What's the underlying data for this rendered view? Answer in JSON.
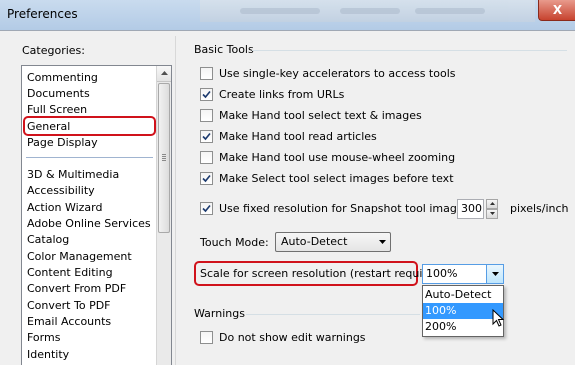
{
  "window": {
    "title": "Preferences",
    "close_glyph": "X"
  },
  "categories": {
    "label": "Categories:",
    "items_top": [
      "Commenting",
      "Documents",
      "Full Screen",
      "General",
      "Page Display"
    ],
    "items_bottom": [
      "3D & Multimedia",
      "Accessibility",
      "Action Wizard",
      "Adobe Online Services",
      "Catalog",
      "Color Management",
      "Content Editing",
      "Convert From PDF",
      "Convert To PDF",
      "Email Accounts",
      "Forms",
      "Identity"
    ],
    "selected": "General"
  },
  "basic_tools": {
    "title": "Basic Tools",
    "options": [
      {
        "label": "Use single-key accelerators to access tools",
        "checked": false
      },
      {
        "label": "Create links from URLs",
        "checked": true
      },
      {
        "label": "Make Hand tool select text & images",
        "checked": false
      },
      {
        "label": "Make Hand tool read articles",
        "checked": true
      },
      {
        "label": "Make Hand tool use mouse-wheel zooming",
        "checked": false
      },
      {
        "label": "Make Select tool select images before text",
        "checked": true
      }
    ],
    "snapshot": {
      "label": "Use fixed resolution for Snapshot tool images:",
      "checked": true,
      "value": "300",
      "unit": "pixels/inch"
    },
    "touch_mode": {
      "label": "Touch Mode:",
      "value": "Auto-Detect"
    },
    "scale": {
      "label": "Scale for screen resolution (restart required):",
      "value": "100%",
      "options": [
        "Auto-Detect",
        "100%",
        "200%"
      ],
      "highlighted": "100%"
    }
  },
  "warnings": {
    "title": "Warnings",
    "option": {
      "label": "Do not show edit warnings",
      "checked": false
    }
  },
  "colors": {
    "highlight_red": "#d0121b",
    "selection_blue": "#3399ff",
    "titlebar_blue": "#c9dbee"
  },
  "icons": [
    "close-icon",
    "scroll-up-arrow-icon",
    "checkmark-icon",
    "spin-up-icon",
    "spin-down-icon",
    "dropdown-arrow-icon",
    "mouse-pointer-icon"
  ]
}
